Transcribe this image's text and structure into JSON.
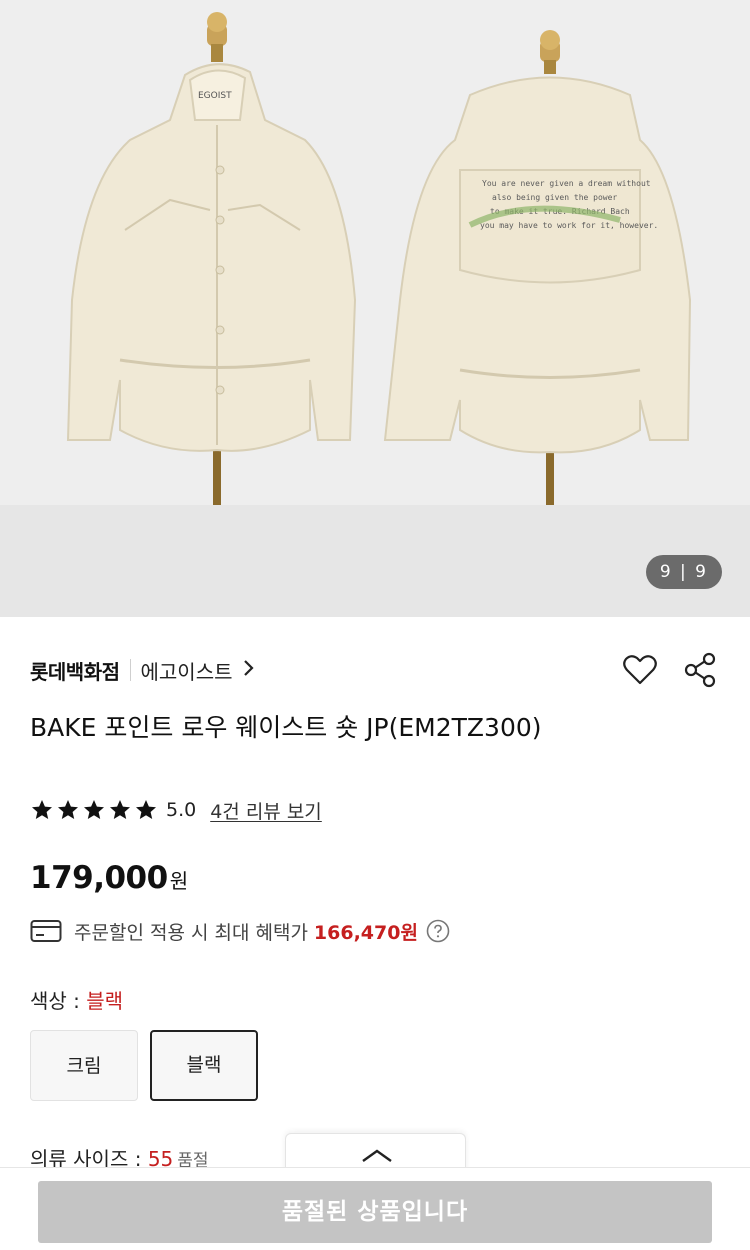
{
  "gallery": {
    "counter": "9 | 9",
    "mannequin_label": "EGOIST",
    "back_print_lines": [
      "You are never given a dream without",
      "also being given the power",
      "to make it true. Richard Bach",
      "you may have to work for it, however."
    ]
  },
  "store": {
    "name": "롯데백화점",
    "brand": "에고이스트"
  },
  "product": {
    "title": "BAKE 포인트 로우 웨이스트 숏 JP(EM2TZ300)",
    "rating": "5.0",
    "rating_stars": 5,
    "review_link": "4건 리뷰 보기",
    "price": "179,000",
    "currency": "원",
    "benefit_text": "주문할인 적용 시 최대 혜택가",
    "benefit_amount": "166,470원"
  },
  "color": {
    "label": "색상 : ",
    "selected": "블랙",
    "options": [
      "크림",
      "블랙"
    ]
  },
  "size": {
    "label": "의류 사이즈 : ",
    "value": "55",
    "status": "품절"
  },
  "bottom": {
    "button_label": "품절된 상품입니다"
  },
  "colors": {
    "accent": "#c51f1f",
    "disabled_button": "#c4c4c4"
  },
  "icons": {
    "wishlist": "heart-icon",
    "share": "share-icon",
    "brand_arrow": "chevron-right-icon",
    "benefit": "card-icon",
    "help": "question-circle-icon",
    "collapse": "chevron-up-icon"
  }
}
